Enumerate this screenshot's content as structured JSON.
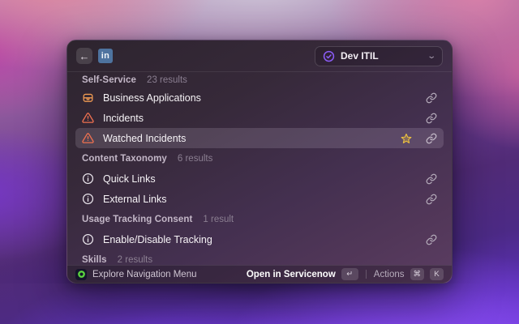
{
  "window": {
    "header": {
      "back_glyph": "←",
      "app_badge": "in",
      "workspace": {
        "label": "Dev ITIL",
        "chevron": "⌄"
      }
    },
    "list": {
      "sections": [
        {
          "title": "Self-Service",
          "count": "23 results",
          "items": [
            {
              "label": "Business Applications"
            },
            {
              "label": "Incidents"
            },
            {
              "label": "Watched Incidents"
            }
          ]
        },
        {
          "title": "Content Taxonomy",
          "count": "6 results",
          "items": [
            {
              "label": "Quick Links"
            },
            {
              "label": "External Links"
            }
          ]
        },
        {
          "title": "Usage Tracking Consent",
          "count": "1 result",
          "items": [
            {
              "label": "Enable/Disable Tracking"
            }
          ]
        },
        {
          "title": "Skills",
          "count": "2 results",
          "items": []
        }
      ]
    },
    "footer": {
      "source_label": "Explore Navigation Menu",
      "primary_action": "Open in Servicenow",
      "primary_key": "↵",
      "secondary_action": "Actions",
      "secondary_keys": [
        "⌘",
        "K"
      ]
    }
  },
  "colors": {
    "accent_purple": "#8b5cf6",
    "warning_orange": "#ef7150",
    "briefcase_orange": "#f09a52",
    "star_gold": "#edc23e",
    "servicenow_green": "#5bd63f",
    "linkedin_blue": "#4e739f"
  }
}
